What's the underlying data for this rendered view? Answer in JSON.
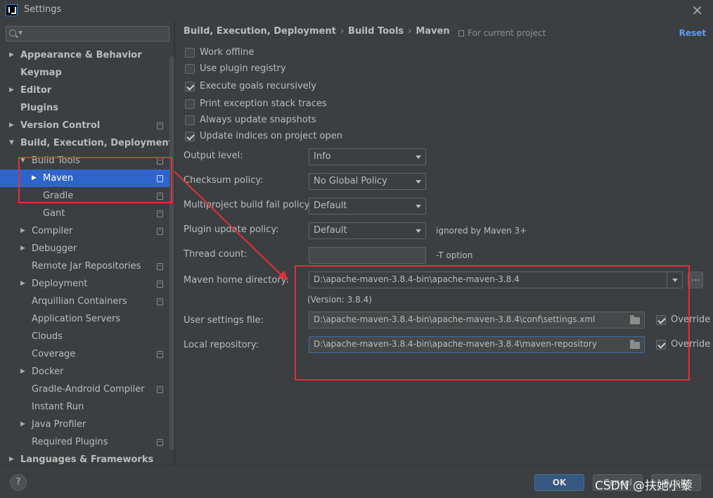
{
  "window": {
    "title": "Settings"
  },
  "search": {
    "placeholder": ""
  },
  "tree": [
    {
      "label": "Appearance & Behavior",
      "arrow": "▶",
      "copy": false
    },
    {
      "label": "Keymap",
      "arrow": "",
      "copy": false
    },
    {
      "label": "Editor",
      "arrow": "▶",
      "copy": false
    },
    {
      "label": "Plugins",
      "arrow": "",
      "copy": false
    },
    {
      "label": "Version Control",
      "arrow": "▶",
      "copy": true
    },
    {
      "label": "Build, Execution, Deployment",
      "arrow": "▼",
      "copy": false
    },
    {
      "label": "Build Tools",
      "arrow": "▼",
      "copy": true
    },
    {
      "label": "Maven",
      "arrow": "▶",
      "copy": true,
      "selected": true
    },
    {
      "label": "Gradle",
      "arrow": "",
      "copy": true
    },
    {
      "label": "Gant",
      "arrow": "",
      "copy": true
    },
    {
      "label": "Compiler",
      "arrow": "▶",
      "copy": true
    },
    {
      "label": "Debugger",
      "arrow": "▶",
      "copy": false
    },
    {
      "label": "Remote Jar Repositories",
      "arrow": "",
      "copy": true
    },
    {
      "label": "Deployment",
      "arrow": "▶",
      "copy": true
    },
    {
      "label": "Arquillian Containers",
      "arrow": "",
      "copy": true
    },
    {
      "label": "Application Servers",
      "arrow": "",
      "copy": false
    },
    {
      "label": "Clouds",
      "arrow": "",
      "copy": false
    },
    {
      "label": "Coverage",
      "arrow": "",
      "copy": true
    },
    {
      "label": "Docker",
      "arrow": "▶",
      "copy": false
    },
    {
      "label": "Gradle-Android Compiler",
      "arrow": "",
      "copy": true
    },
    {
      "label": "Instant Run",
      "arrow": "",
      "copy": false
    },
    {
      "label": "Java Profiler",
      "arrow": "▶",
      "copy": false
    },
    {
      "label": "Required Plugins",
      "arrow": "",
      "copy": true
    },
    {
      "label": "Languages & Frameworks",
      "arrow": "▶",
      "copy": false
    }
  ],
  "breadcrumb": {
    "items": [
      "Build, Execution, Deployment",
      "Build Tools",
      "Maven"
    ],
    "separator": "›"
  },
  "scope_label": "For current project",
  "reset_label": "Reset",
  "checkboxes": [
    {
      "label": "Work offline",
      "checked": false
    },
    {
      "label": "Use plugin registry",
      "checked": false
    },
    {
      "label": "Execute goals recursively",
      "checked": true
    },
    {
      "label": "Print exception stack traces",
      "checked": false
    },
    {
      "label": "Always update snapshots",
      "checked": false
    },
    {
      "label": "Update indices on project open",
      "checked": true
    }
  ],
  "form": {
    "output_level": {
      "label": "Output level:",
      "value": "Info"
    },
    "checksum_policy": {
      "label": "Checksum policy:",
      "value": "No Global Policy"
    },
    "multiproject_fail": {
      "label": "Multiproject build fail policy:",
      "value": "Default"
    },
    "plugin_update": {
      "label": "Plugin update policy:",
      "value": "Default",
      "hint": "ignored by Maven 3+"
    },
    "thread_count": {
      "label": "Thread count:",
      "value": "",
      "hint": "-T option"
    },
    "maven_home": {
      "label": "Maven home directory:",
      "value": "D:\\apache-maven-3.8.4-bin\\apache-maven-3.8.4",
      "browse_label": "...",
      "version": "(Version: 3.8.4)"
    },
    "user_settings": {
      "label": "User settings file:",
      "value": "D:\\apache-maven-3.8.4-bin\\apache-maven-3.8.4\\conf\\settings.xml",
      "override_label": "Override",
      "override_checked": true
    },
    "local_repo": {
      "label": "Local repository:",
      "value": "D:\\apache-maven-3.8.4-bin\\apache-maven-3.8.4\\maven-repository",
      "override_label": "Override",
      "override_checked": true
    }
  },
  "buttons": {
    "help": "?",
    "ok": "OK",
    "cancel": "Cancel",
    "apply": "Apply"
  },
  "watermark": "CSDN @扶她小藜",
  "colors": {
    "selection": "#2f65ca",
    "annotation": "#e0303a",
    "link": "#589df6",
    "ok": "#365880"
  }
}
